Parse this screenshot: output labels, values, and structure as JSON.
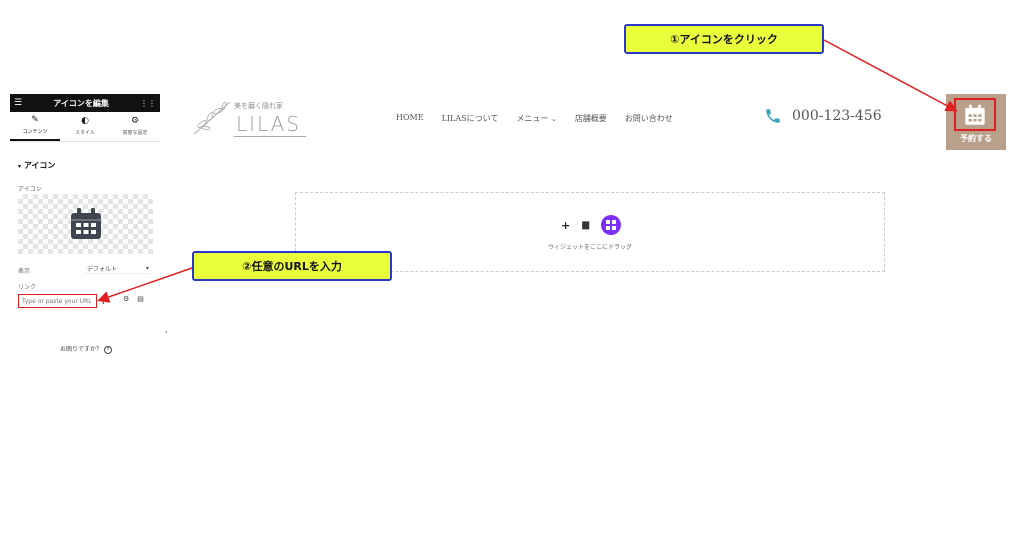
{
  "panel": {
    "title": "アイコンを編集",
    "tabs": [
      {
        "label": "コンテンツ",
        "icon": "pencil-icon"
      },
      {
        "label": "スタイル",
        "icon": "contrast-icon"
      },
      {
        "label": "高度な設定",
        "icon": "gear-icon"
      }
    ],
    "section_title": "アイコン",
    "icon_label": "アイコン",
    "view_label": "表示",
    "view_value": "デフォルト",
    "link_label": "リンク",
    "url_placeholder": "Type or paste your URL",
    "help_text": "お困りですか？"
  },
  "site": {
    "logo_tagline": "美を磨く隠れ家",
    "logo_name": "LILAS",
    "nav": [
      "HOME",
      "LILASについて",
      "メニュー",
      "店舗概要",
      "お問い合わせ"
    ],
    "phone": "000-123-456",
    "reserve_label": "予約する"
  },
  "dropzone": {
    "text": "ウィジェットをここにドラッグ"
  },
  "callouts": {
    "step1": "①アイコンをクリック",
    "step2": "②任意のURLを入力"
  },
  "colors": {
    "callout_bg": "#eaff3c",
    "callout_border": "#2a37c8",
    "arrow": "#e02020",
    "reserve_bg": "#b9a08a",
    "phone_icon": "#3aa6b9",
    "widget_circle": "#7b2ff7"
  }
}
